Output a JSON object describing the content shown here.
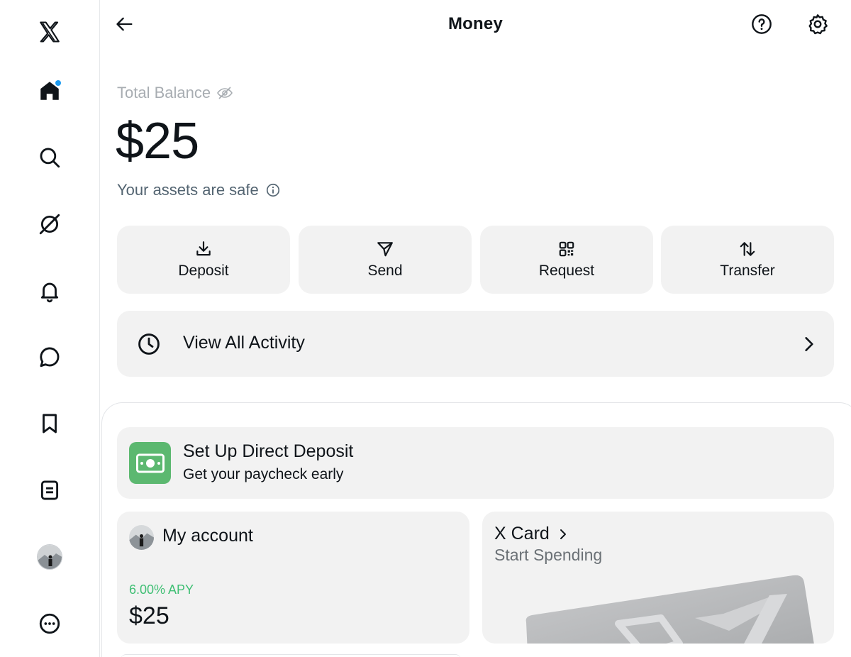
{
  "sidebar": {
    "items": [
      {
        "icon": "x-logo-icon",
        "label": ""
      },
      {
        "icon": "home-icon",
        "label": ""
      },
      {
        "icon": "search-icon",
        "label": ""
      },
      {
        "icon": "grok-icon",
        "label": ""
      },
      {
        "icon": "bell-icon",
        "label": ""
      },
      {
        "icon": "message-icon",
        "label": ""
      },
      {
        "icon": "bookmark-icon",
        "label": ""
      },
      {
        "icon": "list-icon",
        "label": ""
      },
      {
        "icon": "profile-avatar",
        "label": ""
      },
      {
        "icon": "more-icon",
        "label": ""
      }
    ],
    "notification_dot_color": "#1d9bf0"
  },
  "header": {
    "title": "Money",
    "back_icon": "arrow-left-icon",
    "help_icon": "help-circle-icon",
    "settings_icon": "gear-icon"
  },
  "balance": {
    "label": "Total Balance",
    "hide_icon": "eye-off-icon",
    "amount": "$25",
    "assets_note": "Your assets are safe",
    "info_icon": "info-icon"
  },
  "actions": [
    {
      "label": "Deposit",
      "icon": "download-icon"
    },
    {
      "label": "Send",
      "icon": "send-icon"
    },
    {
      "label": "Request",
      "icon": "qr-code-icon"
    },
    {
      "label": "Transfer",
      "icon": "transfer-arrows-icon"
    }
  ],
  "activity": {
    "label": "View All Activity",
    "icon": "clock-icon"
  },
  "direct_deposit": {
    "title": "Set Up Direct Deposit",
    "subtitle": "Get your paycheck early",
    "icon": "cash-icon",
    "icon_color": "#5cb870"
  },
  "account": {
    "title": "My account",
    "apy": "6.00% APY",
    "balance": "$25",
    "apy_color": "#3fbf74"
  },
  "xcard": {
    "title": "X Card",
    "subtitle": "Start Spending"
  }
}
